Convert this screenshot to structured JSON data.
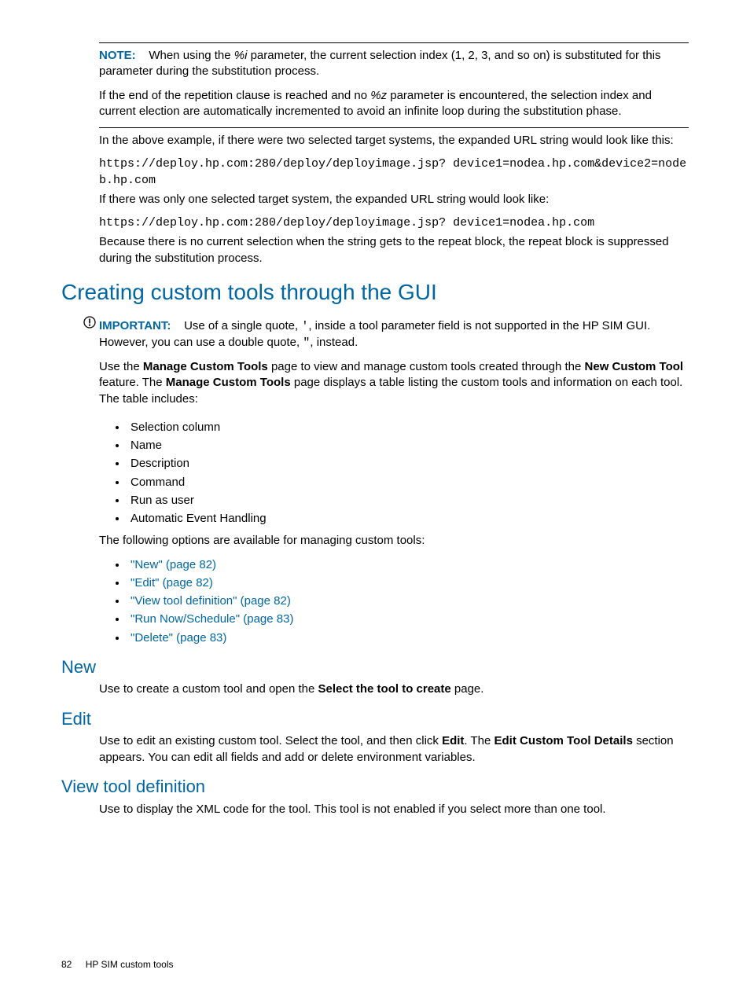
{
  "note": {
    "label": "NOTE:",
    "p1_pre": "When using the ",
    "p1_param": "%i",
    "p1_post": " parameter, the current selection index (1, 2, 3, and so on) is substituted for this parameter during the substitution process.",
    "p2_pre": "If the end of the repetition clause is reached and no ",
    "p2_param": "%z",
    "p2_post": " parameter is encountered, the selection index and current election are automatically incremented to avoid an infinite loop during the substitution phase."
  },
  "example": {
    "intro": "In the above example, if there were two selected target systems, the expanded URL string would look like this:",
    "url1": "https://deploy.hp.com:280/deploy/deployimage.jsp? device1=nodea.hp.com&device2=nodeb.hp.com",
    "one_target": "If there was only one selected target system, the expanded URL string would look like:",
    "url2": "https://deploy.hp.com:280/deploy/deployimage.jsp? device1=nodea.hp.com",
    "suppress": "Because there is no current selection when the string gets to the repeat block, the repeat block is suppressed during the substitution process."
  },
  "h2": "Creating custom tools through the GUI",
  "important": {
    "label": "IMPORTANT:",
    "t1": "Use of a single quote, ",
    "q1": "'",
    "t2": ", inside a tool parameter field is not supported in the HP SIM GUI. However, you can use a double quote, ",
    "q2": "\"",
    "t3": ", instead."
  },
  "manage": {
    "t1": "Use the ",
    "b1": "Manage Custom Tools",
    "t2": " page to view and manage custom tools created through the ",
    "b2": "New Custom Tool",
    "t3": " feature. The ",
    "b3": "Manage Custom Tools",
    "t4": " page displays a table listing the custom tools and information on each tool. The table includes:"
  },
  "table_cols": [
    "Selection column",
    "Name",
    "Description",
    "Command",
    "Run as user",
    "Automatic Event Handling"
  ],
  "options_intro": "The following options are available for managing custom tools:",
  "xrefs": [
    "\"New\" (page 82)",
    "\"Edit\" (page 82)",
    "\"View tool definition\" (page 82)",
    "\"Run Now/Schedule\" (page 83)",
    "\"Delete\" (page 83)"
  ],
  "sec_new": {
    "h": "New",
    "t1": "Use to create a custom tool and open the ",
    "b1": "Select the tool to create",
    "t2": " page."
  },
  "sec_edit": {
    "h": "Edit",
    "t1": "Use to edit an existing custom tool. Select the tool, and then click ",
    "b1": "Edit",
    "t2": ". The ",
    "b2": "Edit Custom Tool Details",
    "t3": " section appears. You can edit all fields and add or delete environment variables."
  },
  "sec_view": {
    "h": "View tool definition",
    "body": "Use to display the XML code for the tool. This tool is not enabled if you select more than one tool."
  },
  "footer": {
    "page": "82",
    "title": "HP SIM custom tools"
  }
}
